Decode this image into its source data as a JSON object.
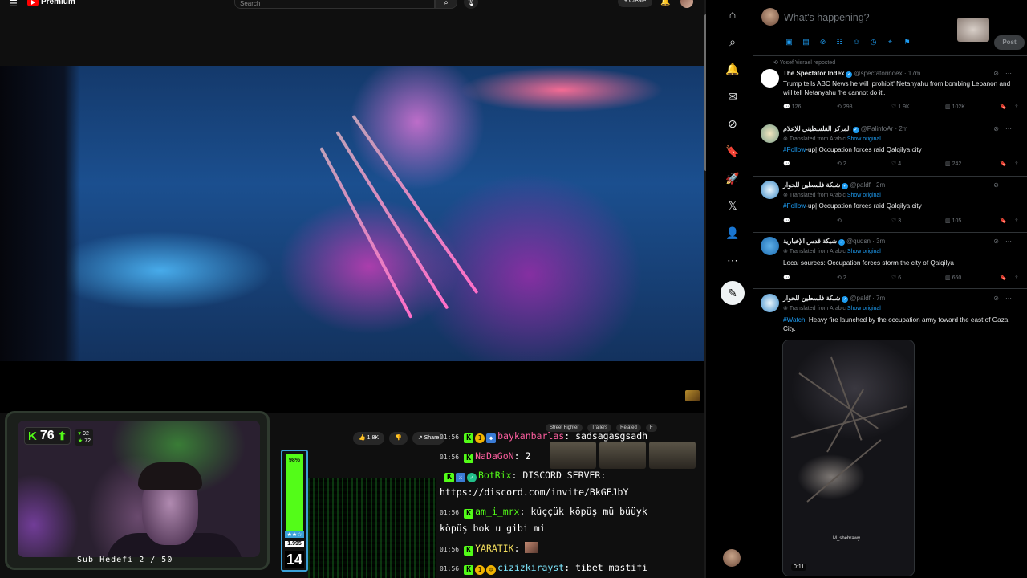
{
  "youtube": {
    "logo_text": "Premium",
    "search_placeholder": "Search",
    "create_label": "+ Create",
    "like_count": "1.8K",
    "share_label": "Share",
    "chips": [
      "Street Fighter",
      "Trailers",
      "Related",
      "F"
    ]
  },
  "stream": {
    "viewer_count": "76",
    "stat_top": "92",
    "stat_bottom": "72",
    "sub_goal": "Sub Hedefi 2 / 50",
    "gauge_percent": "98%",
    "gauge_fill": 0.98,
    "gauge_count": "1.995",
    "gauge_level": "14"
  },
  "chat": [
    {
      "time": "01:56",
      "user": "baykanbarlas",
      "sep": ":",
      "message": "sadsagasgsadh"
    },
    {
      "time": "01:56",
      "user": "NaDaGoN",
      "sep": ":",
      "message": "2"
    },
    {
      "time": "",
      "user": "BotRix",
      "sep": ":",
      "message": "DISCORD SERVER:"
    },
    {
      "time": "",
      "user": "",
      "sep": "",
      "message": "https://discord.com/invite/BkGEJbY"
    },
    {
      "time": "01:56",
      "user": "am_i_mrx",
      "sep": ":",
      "message": "küççük köpüş mü büüyk"
    },
    {
      "time": "",
      "user": "",
      "sep": "",
      "message": "köpüş bok u gibi mi"
    },
    {
      "time": "01:56",
      "user": "YARATIK",
      "sep": ":",
      "message": ""
    },
    {
      "time": "01:56",
      "user": "cizizkirayst",
      "sep": ":",
      "message": "tibet mastifi"
    }
  ],
  "x": {
    "compose_placeholder": "What's happening?",
    "post_label": "Post",
    "tweets": [
      {
        "reposted_by": "Yosef Yisrael reposted",
        "name": "The Spectator Index",
        "handle": "@spectatorindex",
        "time": "· 17m",
        "translated": "",
        "show_original": "",
        "hashtag": "",
        "body": "Trump tells ABC News he will 'prohibit' Netanyahu from bombing Lebanon and will tell Netanyahu 'he cannot do it'.",
        "replies": "126",
        "reposts": "298",
        "likes": "1.9K",
        "views": "102K"
      },
      {
        "reposted_by": "",
        "name": "المركز الفلسطيني للإعلام",
        "handle": "@PalinfoAr",
        "time": "· 2m",
        "translated": "Translated from Arabic",
        "show_original": "Show original",
        "hashtag": "#Follow",
        "body": "-up| Occupation forces raid Qalqilya city",
        "replies": "",
        "reposts": "2",
        "likes": "4",
        "views": "242"
      },
      {
        "reposted_by": "",
        "name": "شبكة فلسطين للحوار",
        "handle": "@paldf",
        "time": "· 2m",
        "translated": "Translated from Arabic",
        "show_original": "Show original",
        "hashtag": "#Follow",
        "body": "-up| Occupation forces raid Qalqilya city",
        "replies": "",
        "reposts": "",
        "likes": "3",
        "views": "105"
      },
      {
        "reposted_by": "",
        "name": "شبكة قدس الإخبارية",
        "handle": "@qudsn",
        "time": "· 3m",
        "translated": "Translated from Arabic",
        "show_original": "Show original",
        "hashtag": "",
        "body": "Local sources: Occupation forces storm the city of Qalqilya",
        "replies": "",
        "reposts": "2",
        "likes": "6",
        "views": "660"
      },
      {
        "reposted_by": "",
        "name": "شبكة فلسطين للحوار",
        "handle": "@paldf",
        "time": "· 7m",
        "translated": "Translated from Arabic",
        "show_original": "Show original",
        "hashtag": "#Watch",
        "body": "| Heavy fire launched by the occupation army toward the east of Gaza City.",
        "media_watermark": "M_shebrawy",
        "media_time": "0:11"
      }
    ]
  },
  "colors": {
    "kick_green": "#53fc18",
    "x_blue": "#1d9bf0",
    "yt_red": "#ff0000"
  }
}
